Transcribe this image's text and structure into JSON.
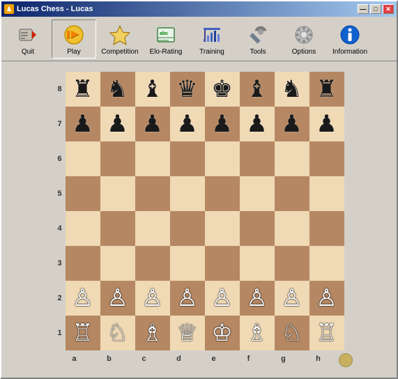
{
  "window": {
    "title": "Lucas Chess - Lucas",
    "icon": "♟"
  },
  "titleButtons": {
    "minimize": "—",
    "maximize": "□",
    "close": "✕"
  },
  "toolbar": {
    "buttons": [
      {
        "id": "quit",
        "label": "Quit",
        "icon": "quit"
      },
      {
        "id": "play",
        "label": "Play",
        "icon": "play",
        "active": true
      },
      {
        "id": "competition",
        "label": "Competition",
        "icon": "competition"
      },
      {
        "id": "elo-rating",
        "label": "Elo-Rating",
        "icon": "elo"
      },
      {
        "id": "training",
        "label": "Training",
        "icon": "training"
      },
      {
        "id": "tools",
        "label": "Tools",
        "icon": "tools"
      },
      {
        "id": "options",
        "label": "Options",
        "icon": "options"
      },
      {
        "id": "information",
        "label": "Information",
        "icon": "information"
      }
    ]
  },
  "board": {
    "ranks": [
      "8",
      "7",
      "6",
      "5",
      "4",
      "3",
      "2",
      "1"
    ],
    "files": [
      "a",
      "b",
      "c",
      "d",
      "e",
      "f",
      "g",
      "h"
    ],
    "pieces": {
      "8": [
        "♜",
        "♞",
        "♝",
        "♛",
        "♚",
        "♝",
        "♞",
        "♜"
      ],
      "7": [
        "♟",
        "♟",
        "♟",
        "♟",
        "♟",
        "♟",
        "♟",
        "♟"
      ],
      "6": [
        "",
        "",
        "",
        "",
        "",
        "",
        "",
        ""
      ],
      "5": [
        "",
        "",
        "",
        "",
        "",
        "",
        "",
        ""
      ],
      "4": [
        "",
        "",
        "",
        "",
        "",
        "",
        "",
        ""
      ],
      "3": [
        "",
        "",
        "",
        "",
        "",
        "",
        "",
        ""
      ],
      "2": [
        "♙",
        "♙",
        "♙",
        "♙",
        "♙",
        "♙",
        "♙",
        "♙"
      ],
      "1": [
        "♖",
        "♘",
        "♗",
        "♕",
        "♔",
        "♗",
        "♘",
        "♖"
      ]
    },
    "pieceColors": {
      "8": [
        "black",
        "black",
        "black",
        "black",
        "black",
        "black",
        "black",
        "black"
      ],
      "7": [
        "black",
        "black",
        "black",
        "black",
        "black",
        "black",
        "black",
        "black"
      ],
      "6": [
        "",
        "",
        "",
        "",
        "",
        "",
        "",
        ""
      ],
      "5": [
        "",
        "",
        "",
        "",
        "",
        "",
        "",
        ""
      ],
      "4": [
        "",
        "",
        "",
        "",
        "",
        "",
        "",
        ""
      ],
      "3": [
        "",
        "",
        "",
        "",
        "",
        "",
        "",
        ""
      ],
      "2": [
        "white",
        "white",
        "white",
        "white",
        "white",
        "white",
        "white",
        "white"
      ],
      "1": [
        "white",
        "white",
        "white",
        "white",
        "white",
        "white",
        "white",
        "white"
      ]
    }
  }
}
